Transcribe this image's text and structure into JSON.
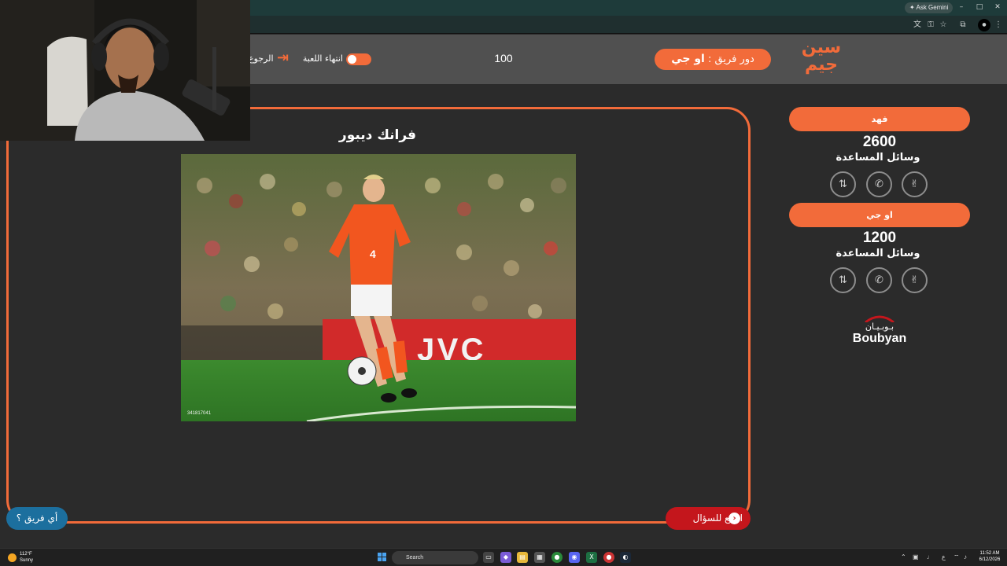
{
  "browser": {
    "gemini_label": "Ask Gemini",
    "controls": {
      "minimize": "–",
      "maximize": "□",
      "close": "✕"
    },
    "toolbar_icons": [
      "translate-icon",
      "password-icon",
      "star-icon",
      "extensions-icon",
      "profile-icon",
      "menu-icon"
    ]
  },
  "header": {
    "logo_line1": "سين",
    "logo_line2": "جيم",
    "turn_prefix": "دور فريق :",
    "turn_team": "او جي",
    "points": "100",
    "end_game_label": "انتهاء اللعبة",
    "back_label": "الرجوع"
  },
  "question": {
    "answer_title": "فرانك ديبور",
    "photo_id": "341817041",
    "back_to_question_label": "ارجع للسؤال",
    "which_team_label": "أي فريق ؟"
  },
  "teams": [
    {
      "name": "فهد",
      "score": "2600",
      "aids_label": "وسائل المساعدة"
    },
    {
      "name": "او جي",
      "score": "1200",
      "aids_label": "وسائل المساعدة"
    }
  ],
  "sponsor": {
    "arabic": "بـوبـيـان",
    "english": "Boubyan"
  },
  "taskbar": {
    "weather_temp": "112°F",
    "weather_desc": "Sunny",
    "search_label": "Search",
    "time": "11:52 AM",
    "date": "6/12/2026"
  },
  "colors": {
    "accent": "#f26b3a",
    "header_bg": "#505050",
    "page_bg": "#2b2b2b",
    "back_button": "#c4161c",
    "team_button": "#1c6f9e"
  }
}
